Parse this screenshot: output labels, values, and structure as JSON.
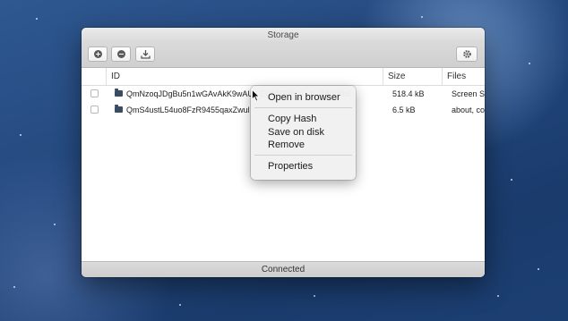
{
  "window": {
    "title": "Storage"
  },
  "toolbar": {
    "buttons": [
      {
        "name": "add-button",
        "icon": "plus-circle-icon"
      },
      {
        "name": "remove-button",
        "icon": "minus-circle-icon"
      },
      {
        "name": "download-button",
        "icon": "download-icon"
      }
    ],
    "settings_icon": "gear-icon"
  },
  "table": {
    "columns": [
      "ID",
      "Size",
      "Files"
    ],
    "rows": [
      {
        "id": "QmNzoqJDgBu5n1wGAvAkK9wAU...EQVBBRCs...f...2WYBb6",
        "size": "518.4 kB",
        "files": "Screen S"
      },
      {
        "id": "QmS4ustL54uo8FzR9455qaxZwul",
        "size": "6.5 kB",
        "files": "about, co"
      }
    ]
  },
  "context_menu": {
    "items": [
      "Open in browser",
      "Copy Hash",
      "Save on disk",
      "Remove",
      "Properties"
    ]
  },
  "status": {
    "text": "Connected"
  },
  "colors": {
    "folder": "#3b4c62",
    "toolbar": "#d4d4d4",
    "background": "#23487e"
  }
}
